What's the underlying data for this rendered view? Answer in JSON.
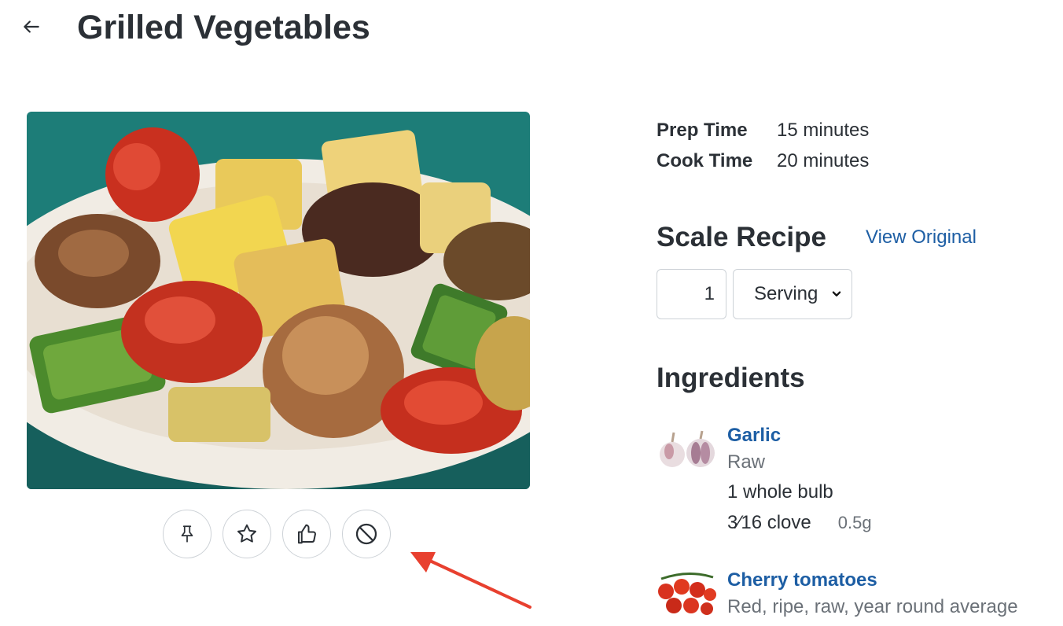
{
  "header": {
    "title": "Grilled Vegetables",
    "back_icon": "arrow-left-icon"
  },
  "recipe_image": {
    "subject": "grilled-vegetables-photo"
  },
  "actions": [
    {
      "icon": "pin-icon"
    },
    {
      "icon": "star-icon"
    },
    {
      "icon": "thumbs-up-icon"
    },
    {
      "icon": "block-icon"
    }
  ],
  "times": [
    {
      "label": "Prep Time",
      "value": "15 minutes"
    },
    {
      "label": "Cook Time",
      "value": "20 minutes"
    }
  ],
  "scale": {
    "heading": "Scale Recipe",
    "view_original": "View Original",
    "quantity": "1",
    "unit": "Serving"
  },
  "ingredients": {
    "heading": "Ingredients",
    "items": [
      {
        "name": "Garlic",
        "description": "Raw",
        "amount": "1 whole bulb",
        "alt_amount": "3⁄16 clove",
        "weight": "0.5g"
      },
      {
        "name": "Cherry tomatoes",
        "description": "Red, ripe, raw, year round average"
      }
    ]
  },
  "colors": {
    "text": "#2b3036",
    "link": "#1d5ea4",
    "annotation_arrow": "#e8402f",
    "border": "#cdd2d7"
  }
}
